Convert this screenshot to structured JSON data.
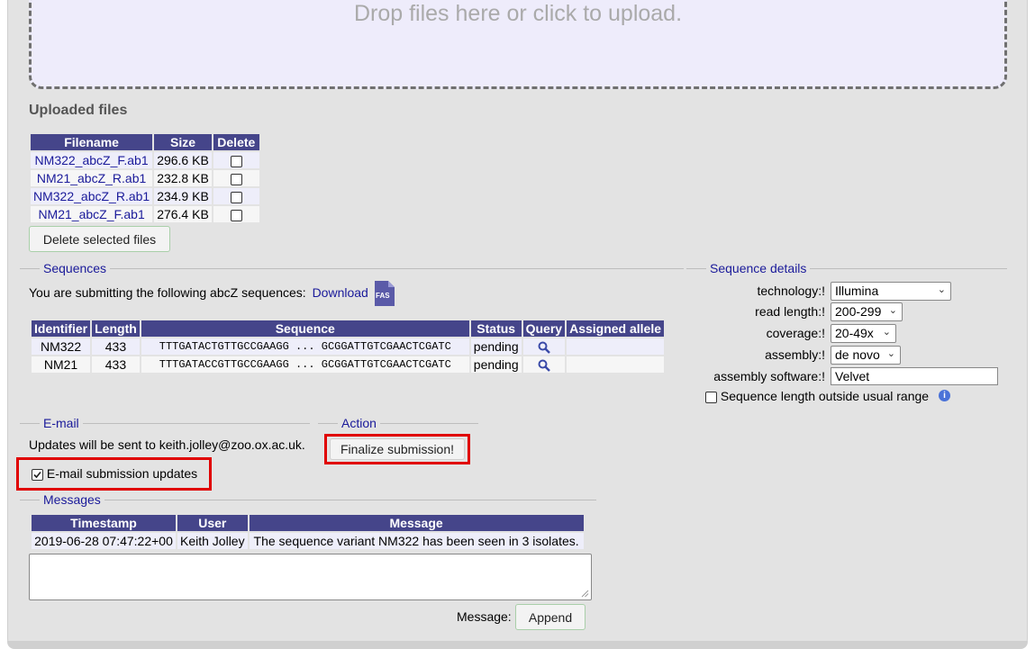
{
  "dropzone": {
    "text": "Drop files here or click to upload."
  },
  "uploaded": {
    "heading": "Uploaded files",
    "columns": [
      "Filename",
      "Size",
      "Delete"
    ],
    "rows": [
      {
        "filename": "NM322_abcZ_F.ab1",
        "size": "296.6 KB"
      },
      {
        "filename": "NM21_abcZ_R.ab1",
        "size": "232.8 KB"
      },
      {
        "filename": "NM322_abcZ_R.ab1",
        "size": "234.9 KB"
      },
      {
        "filename": "NM21_abcZ_F.ab1",
        "size": "276.4 KB"
      }
    ],
    "delete_button": "Delete selected files"
  },
  "sequences": {
    "legend": "Sequences",
    "intro": "You are submitting the following abcZ sequences:",
    "download": "Download",
    "fas_icon_text": "FAS",
    "columns": [
      "Identifier",
      "Length",
      "Sequence",
      "Status",
      "Query",
      "Assigned allele"
    ],
    "rows": [
      {
        "id": "NM322",
        "length": "433",
        "seq": "TTTGATACTGTTGCCGAAGG ... GCGGATTGTCGAACTCGATC",
        "status": "pending",
        "allele": ""
      },
      {
        "id": "NM21",
        "length": "433",
        "seq": "TTTGATACCGTTGCCGAAGG ... GCGGATTGTCGAACTCGATC",
        "status": "pending",
        "allele": ""
      }
    ]
  },
  "details": {
    "legend": "Sequence details",
    "technology": {
      "label": "technology:!",
      "value": "Illumina"
    },
    "read_length": {
      "label": "read length:!",
      "value": "200-299"
    },
    "coverage": {
      "label": "coverage:!",
      "value": "20-49x"
    },
    "assembly": {
      "label": "assembly:!",
      "value": "de novo"
    },
    "assembly_software": {
      "label": "assembly software:!",
      "value": "Velvet"
    },
    "length_checkbox": "Sequence length outside usual range",
    "info_icon_text": "i"
  },
  "email": {
    "legend": "E-mail",
    "text": "Updates will be sent to keith.jolley@zoo.ox.ac.uk.",
    "checkbox_label": "E-mail submission updates",
    "checked": true
  },
  "action": {
    "legend": "Action",
    "finalize": "Finalize submission!"
  },
  "messages": {
    "legend": "Messages",
    "columns": [
      "Timestamp",
      "User",
      "Message"
    ],
    "rows": [
      {
        "timestamp": "2019-06-28 07:47:22+00",
        "user": "Keith Jolley",
        "message": "The sequence variant NM322 has been seen in 3 isolates."
      }
    ],
    "message_label": "Message:",
    "append_button": "Append"
  },
  "colors": {
    "header_bg": "#45458a",
    "link": "#1a1a9a",
    "highlight": "#e00000",
    "panel_bg": "#e3e3e3"
  }
}
